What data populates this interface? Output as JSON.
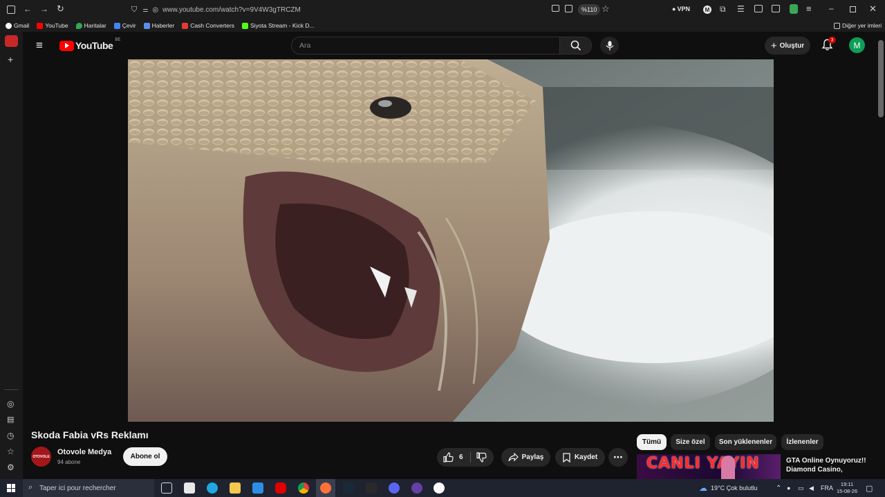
{
  "browser": {
    "url": "www.youtube.com/watch?v=9V4W3gTRCZM",
    "zoom": "%110",
    "vpn_label": "VPN",
    "bookmarks": [
      {
        "label": "Gmail",
        "color": "#ffffff"
      },
      {
        "label": "YouTube",
        "color": "#ff0000"
      },
      {
        "label": "Haritalar",
        "color": "#34a853"
      },
      {
        "label": "Çevir",
        "color": "#4285f4"
      },
      {
        "label": "Haberler",
        "color": "#5b8def"
      },
      {
        "label": "Cash Converters",
        "color": "#e53935"
      },
      {
        "label": "Siyota Stream - Kick D...",
        "color": "#53fc18"
      }
    ],
    "other_bookmarks": "Diğer yer imleri"
  },
  "youtube": {
    "logo": "YouTube",
    "region": "BE",
    "search_placeholder": "Ara",
    "create_label": "Oluştur",
    "notif_count": "3",
    "avatar_letter": "M",
    "avatar_color": "#0f9d58"
  },
  "video": {
    "title": "Skoda Fabia vRs Reklamı",
    "channel": "Otovole Medya",
    "channel_logo": "OTOVOLE",
    "subscribers": "94 abone",
    "subscribe_label": "Abone ol",
    "likes": "6",
    "share_label": "Paylaş",
    "save_label": "Kaydet"
  },
  "chips": [
    "Tümü",
    "Size özel",
    "Son yüklenenler",
    "İzlenenler"
  ],
  "suggestion": {
    "thumb_text": "CANLI YAYIN",
    "title": "GTA Online Oynuyoruz!! Diamond Casino,"
  },
  "taskbar": {
    "search_placeholder": "Taper ici pour rechercher",
    "weather": "19°C  Çok bulutlu",
    "lang": "FRA",
    "time": "19:11",
    "date": "15-08-26"
  },
  "colors": {
    "brand_red": "#ff0000",
    "bg": "#0f0f0f",
    "chip_bg": "#272727"
  }
}
